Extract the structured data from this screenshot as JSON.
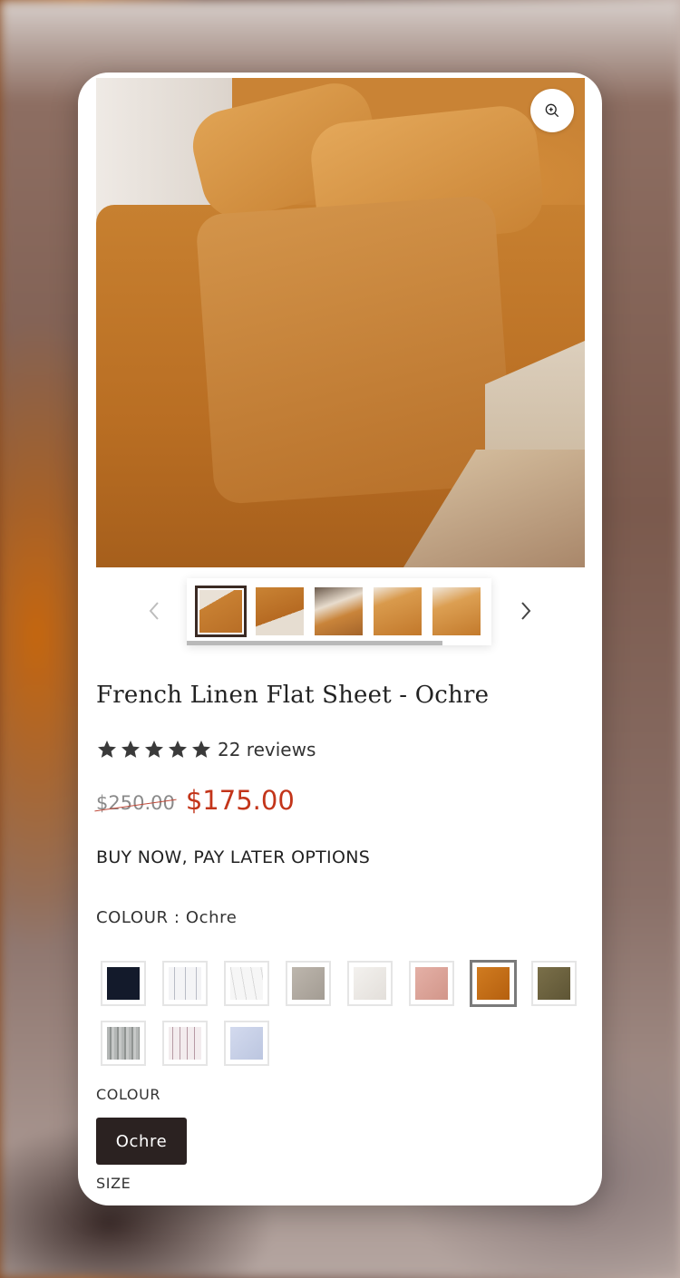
{
  "product": {
    "title": "French Linen Flat Sheet - Ochre",
    "reviews": "22 reviews",
    "rating_stars": 5,
    "compare_price": "$250.00",
    "sale_price": "$175.00",
    "bnpl": "BUY NOW, PAY LATER OPTIONS"
  },
  "gallery": {
    "zoom_icon": "zoom-in-icon",
    "prev_icon": "chevron-left-icon",
    "next_icon": "chevron-right-icon",
    "thumbnails": 5,
    "selected_thumbnail": 1
  },
  "colour_picker": {
    "label": "COLOUR : Ochre",
    "selected": 7,
    "swatches": [
      {
        "color": "#131a2b",
        "pattern": "solid"
      },
      {
        "color": "#f1f1f3",
        "pattern": "stripe-grey"
      },
      {
        "color": "#f3f3f3",
        "pattern": "stripe-light"
      },
      {
        "color": "#b1aaa1",
        "pattern": "solid"
      },
      {
        "color": "#ece9e5",
        "pattern": "solid"
      },
      {
        "color": "#dba398",
        "pattern": "solid"
      },
      {
        "color": "#c16d16",
        "pattern": "solid"
      },
      {
        "color": "#6e6340",
        "pattern": "solid"
      },
      {
        "color": "#a7aaa9",
        "pattern": "stripe-dark"
      },
      {
        "color": "#f0e8ea",
        "pattern": "stripe-rose"
      },
      {
        "color": "#c9d1e6",
        "pattern": "solid"
      }
    ]
  },
  "variant": {
    "colour_label": "COLOUR",
    "colour_option": "Ochre",
    "size_label": "SIZE"
  },
  "colors": {
    "sale": "#c3351a",
    "button_bg": "#2b2221"
  }
}
